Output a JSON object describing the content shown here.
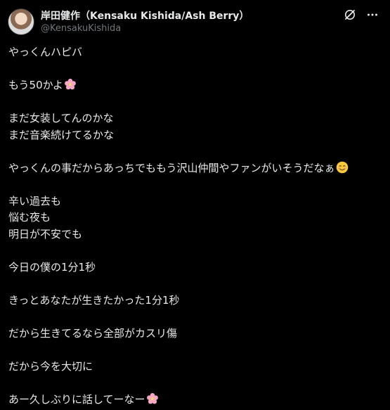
{
  "author": {
    "display_name": "岸田健作（Kensaku Kishida/Ash Berry）",
    "handle": "@KensakuKishida"
  },
  "icons": {
    "grok": "grok-icon",
    "more": "more-icon",
    "emoji_flower": "cherry-blossom-emoji",
    "emoji_smile": "smiling-face-emoji"
  },
  "colors": {
    "background": "#000000",
    "text": "#e7e9ea",
    "muted": "#71767b"
  },
  "post": {
    "lines": [
      "やっくんハピバ",
      "",
      "もう50かよ",
      "",
      "まだ女装してんのかな",
      "まだ音楽続けてるかな",
      "",
      "やっくんの事だからあっちでももう沢山仲間やファンがいそうだなぁ",
      "",
      "辛い過去も",
      "悩む夜も",
      "明日が不安でも",
      "",
      "今日の僕の1分1秒",
      "",
      "きっとあなたが生きたかった1分1秒",
      "",
      "だから生きてるなら全部がカスリ傷",
      "",
      "だから今を大切に",
      "",
      "あー久しぶりに話してーなー"
    ]
  }
}
